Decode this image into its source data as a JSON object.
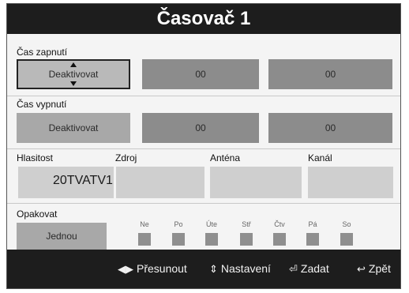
{
  "title": "Časovač 1",
  "on_time": {
    "label": "Čas zapnutí",
    "mode": "Deaktivovat",
    "hour": "00",
    "minute": "00"
  },
  "off_time": {
    "label": "Čas vypnutí",
    "mode": "Deaktivovat",
    "hour": "00",
    "minute": "00"
  },
  "volume": {
    "label": "Hlasitost",
    "value": "20"
  },
  "source": {
    "label": "Zdroj",
    "value": "TV"
  },
  "antenna": {
    "label": "Anténa",
    "value": "ATV"
  },
  "channel": {
    "label": "Kanál",
    "value": "1"
  },
  "repeat": {
    "label": "Opakovat",
    "value": "Jednou",
    "days": [
      "Ne",
      "Po",
      "Úte",
      "Stř",
      "Čtv",
      "Pá",
      "So"
    ]
  },
  "footer": {
    "move": "Přesunout",
    "adjust": "Nastavení",
    "enter": "Zadat",
    "back": "Zpět"
  },
  "icons": {
    "move": "left-right-arrows-icon",
    "adjust": "up-down-arrows-icon",
    "enter": "enter-key-icon",
    "back": "return-arrow-icon"
  },
  "colors": {
    "title_bar": "#1d1d1d",
    "field": "#a8a8a8",
    "field_dark": "#8c8c8c",
    "field_light": "#cfcfcf",
    "background": "#f4f4f4"
  }
}
